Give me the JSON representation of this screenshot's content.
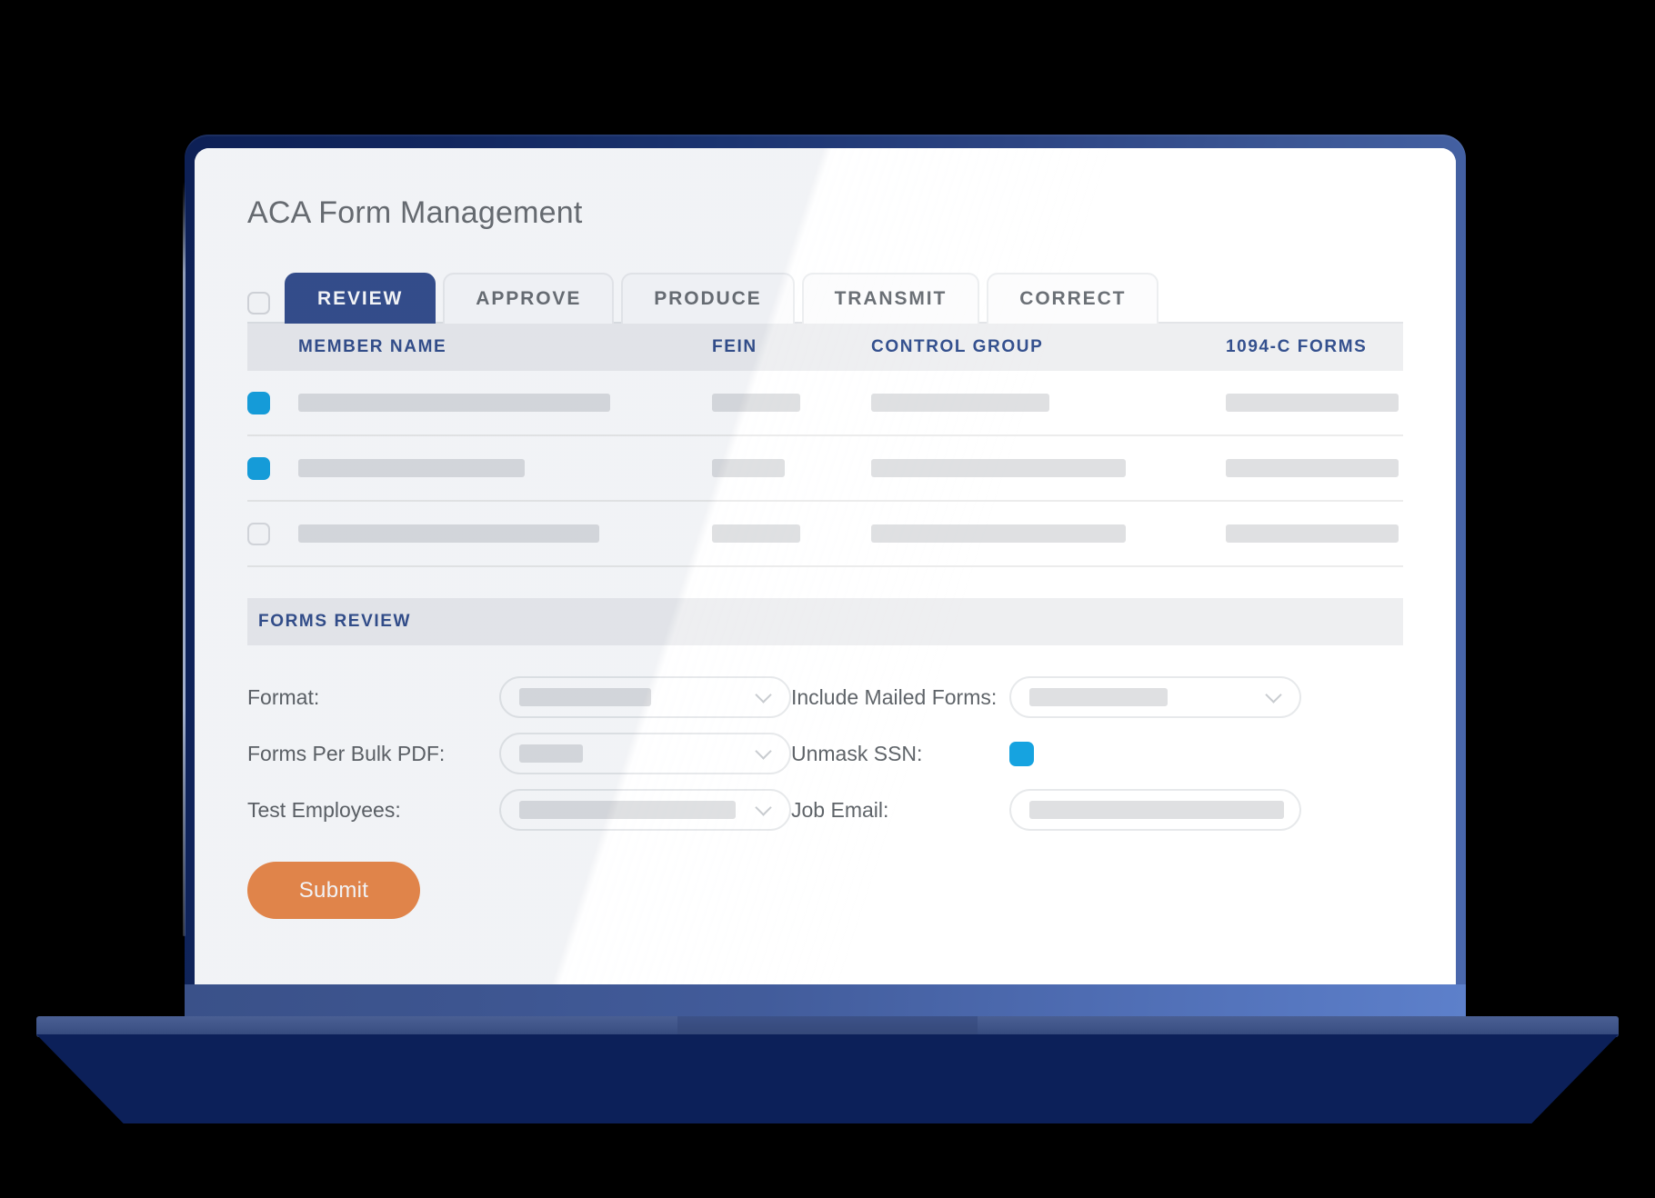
{
  "app": {
    "title": "ACA Form Management"
  },
  "tabs": {
    "select_all_checked": false,
    "items": [
      {
        "label": "REVIEW",
        "active": true
      },
      {
        "label": "APPROVE",
        "active": false
      },
      {
        "label": "PRODUCE",
        "active": false
      },
      {
        "label": "TRANSMIT",
        "active": false
      },
      {
        "label": "CORRECT",
        "active": false
      }
    ]
  },
  "table": {
    "columns": [
      "MEMBER NAME",
      "FEIN",
      "CONTROL GROUP",
      "1094-C FORMS"
    ],
    "rows": [
      {
        "checked": true,
        "name_width": 343,
        "fein_width": 97,
        "group_width": 196,
        "forms_width": 190
      },
      {
        "checked": true,
        "name_width": 249,
        "fein_width": 80,
        "group_width": 280,
        "forms_width": 190
      },
      {
        "checked": false,
        "name_width": 331,
        "fein_width": 97,
        "group_width": 280,
        "forms_width": 190
      }
    ]
  },
  "forms_review": {
    "section_label": "FORMS REVIEW",
    "fields": {
      "format_label": "Format:",
      "format_value_width": 145,
      "forms_per_bulk_pdf_label": "Forms Per Bulk PDF:",
      "forms_per_bulk_pdf_value_width": 70,
      "test_employees_label": "Test Employees:",
      "test_employees_value_width": 238,
      "include_mailed_forms_label": "Include Mailed Forms:",
      "include_mailed_forms_value_width": 152,
      "unmask_ssn_label": "Unmask SSN:",
      "unmask_ssn_checked": true,
      "job_email_label": "Job Email:",
      "job_email_value_width": 280
    },
    "submit_label": "Submit"
  },
  "colors": {
    "tab_active_bg": "#36508f",
    "header_text": "#34508e",
    "checkbox_on": "#16a3e0",
    "submit_bg": "#ed8b4d",
    "band_bg": "#eeeff1",
    "bezel_dark": "#0c2059",
    "bezel_light": "#5d80cb"
  }
}
